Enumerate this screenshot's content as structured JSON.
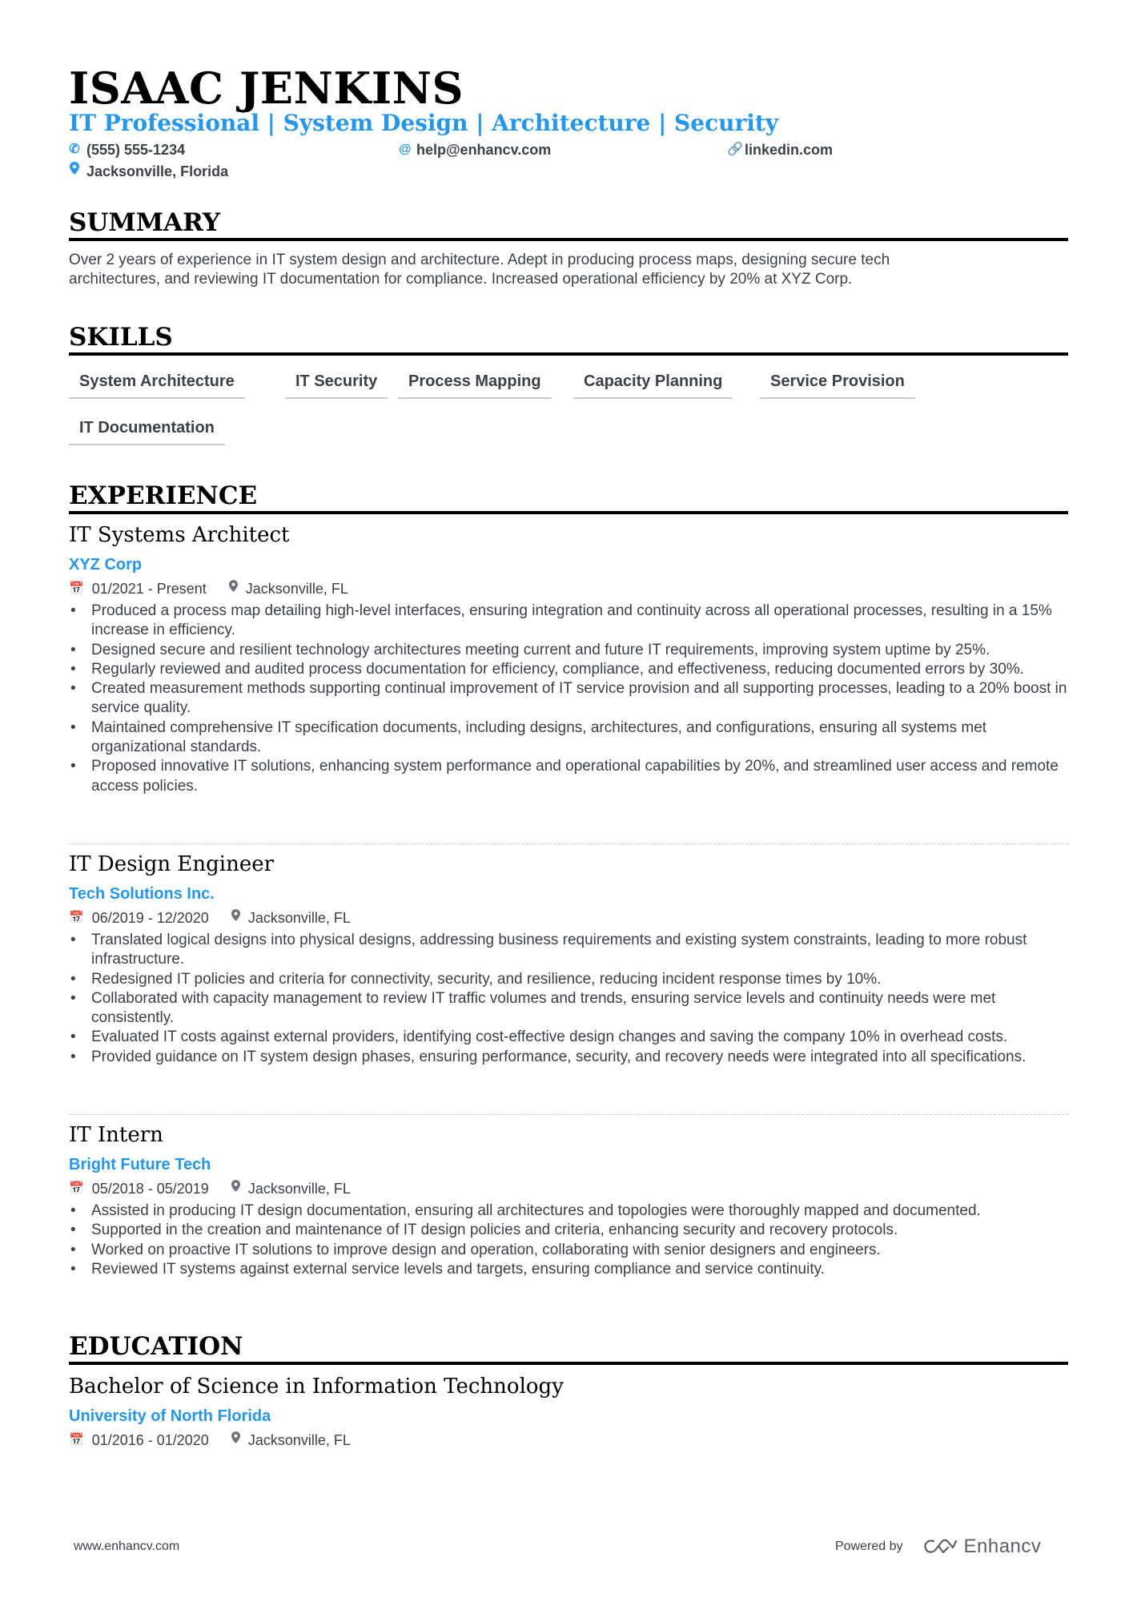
{
  "header": {
    "name": "ISAAC JENKINS",
    "headline": "IT Professional | System Design | Architecture | Security",
    "contacts": {
      "phone": {
        "icon": "phone-icon",
        "text": "(555) 555-1234"
      },
      "email": {
        "icon": "at-icon",
        "text": "help@enhancv.com"
      },
      "linkedin": {
        "icon": "link-icon",
        "text": "linkedin.com"
      },
      "location": {
        "icon": "map-pin-icon",
        "text": "Jacksonville, Florida"
      }
    }
  },
  "summary": {
    "title": "SUMMARY",
    "lines": [
      "Over 2 years of experience in IT system design and architecture. Adept in producing process maps, designing secure tech",
      "architectures, and reviewing IT documentation for compliance. Increased operational efficiency by 20% at XYZ Corp."
    ]
  },
  "skills": {
    "title": "SKILLS",
    "items": [
      "System Architecture",
      "IT Security",
      "Process Mapping",
      "Capacity Planning",
      "Service Provision",
      "IT Documentation"
    ]
  },
  "experience": {
    "title": "EXPERIENCE",
    "jobs": [
      {
        "title": "IT Systems Architect",
        "company": "XYZ Corp",
        "dates": "01/2021 - Present",
        "location": "Jacksonville, FL",
        "bullets": [
          "Produced a process map detailing high-level interfaces, ensuring integration and continuity across all operational processes, resulting in a 15% increase in efficiency.",
          "Designed secure and resilient technology architectures meeting current and future IT requirements, improving system uptime by 25%.",
          "Regularly reviewed and audited process documentation for efficiency, compliance, and effectiveness, reducing documented errors by 30%.",
          "Created measurement methods supporting continual improvement of IT service provision and all supporting processes, leading to a 20% boost in service quality.",
          "Maintained comprehensive IT specification documents, including designs, architectures, and configurations, ensuring all systems met organizational standards.",
          "Proposed innovative IT solutions, enhancing system performance and operational capabilities by 20%, and streamlined user access and remote access policies."
        ]
      },
      {
        "title": "IT Design Engineer",
        "company": "Tech Solutions Inc.",
        "dates": "06/2019 - 12/2020",
        "location": "Jacksonville, FL",
        "bullets": [
          "Translated logical designs into physical designs, addressing business requirements and existing system constraints, leading to more robust infrastructure.",
          "Redesigned IT policies and criteria for connectivity, security, and resilience, reducing incident response times by 10%.",
          "Collaborated with capacity management to review IT traffic volumes and trends, ensuring service levels and continuity needs were met consistently.",
          "Evaluated IT costs against external providers, identifying cost-effective design changes and saving the company 10% in overhead costs.",
          "Provided guidance on IT system design phases, ensuring performance, security, and recovery needs were integrated into all specifications."
        ]
      },
      {
        "title": "IT Intern",
        "company": "Bright Future Tech",
        "dates": "05/2018 - 05/2019",
        "location": "Jacksonville, FL",
        "bullets": [
          "Assisted in producing IT design documentation, ensuring all architectures and topologies were thoroughly mapped and documented.",
          "Supported in the creation and maintenance of IT design policies and criteria, enhancing security and recovery protocols.",
          "Worked on proactive IT solutions to improve design and operation, collaborating with senior designers and engineers.",
          "Reviewed IT systems against external service levels and targets, ensuring compliance and service continuity."
        ]
      }
    ]
  },
  "education": {
    "title": "EDUCATION",
    "items": [
      {
        "degree": "Bachelor of Science in Information Technology",
        "school": "University of North Florida",
        "dates": "01/2016 - 01/2020",
        "location": "Jacksonville, FL"
      }
    ]
  },
  "footer": {
    "website": "www.enhancv.com",
    "powered_by": "Powered by",
    "brand": "Enhancv"
  },
  "colors": {
    "accent": "#2196f3",
    "text": "#3b4147",
    "heading": "#000000"
  }
}
